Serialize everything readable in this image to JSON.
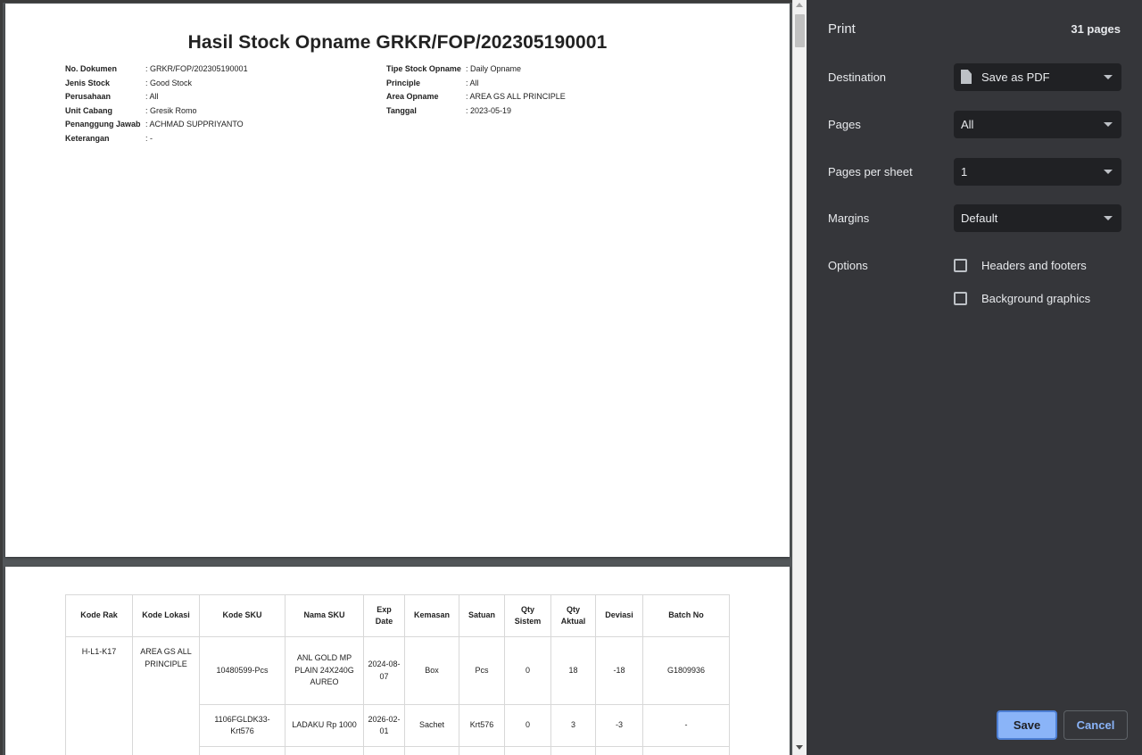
{
  "document": {
    "title": "Hasil Stock Opname GRKR/FOP/202305190001",
    "meta_left": [
      {
        "key": "No. Dokumen",
        "value": ": GRKR/FOP/202305190001"
      },
      {
        "key": "Jenis Stock",
        "value": ": Good Stock"
      },
      {
        "key": "Perusahaan",
        "value": ": All"
      },
      {
        "key": "Unit Cabang",
        "value": ": Gresik Romo"
      },
      {
        "key": "Penanggung Jawab",
        "value": ": ACHMAD SUPPRIYANTO"
      },
      {
        "key": "Keterangan",
        "value": ": -"
      }
    ],
    "meta_right": [
      {
        "key": "Tipe Stock Opname",
        "value": ": Daily Opname"
      },
      {
        "key": "Principle",
        "value": ": All"
      },
      {
        "key": "Area Opname",
        "value": ": AREA GS ALL PRINCIPLE"
      },
      {
        "key": "Tanggal",
        "value": ": 2023-05-19"
      }
    ]
  },
  "table": {
    "headers": [
      "Kode Rak",
      "Kode Lokasi",
      "Kode SKU",
      "Nama SKU",
      "Exp Date",
      "Kemasan",
      "Satuan",
      "Qty Sistem",
      "Qty Aktual",
      "Deviasi",
      "Batch No"
    ],
    "rak": "H-L1-K17",
    "lokasi": "AREA GS ALL PRINCIPLE",
    "rows": [
      {
        "sku": "10480599-Pcs",
        "nama": "ANL GOLD MP PLAIN 24X240G AUREO",
        "exp": "2024-08-07",
        "kemasan": "Box",
        "satuan": "Pcs",
        "qty_sistem": "0",
        "qty_aktual": "18",
        "deviasi": "-18",
        "batch": "G1809936"
      },
      {
        "sku": "1106FGLDK33-Krt576",
        "nama": "LADAKU Rp 1000",
        "exp": "2026-02-01",
        "kemasan": "Sachet",
        "satuan": "Krt576",
        "qty_sistem": "0",
        "qty_aktual": "3",
        "deviasi": "-3",
        "batch": "-"
      }
    ]
  },
  "panel": {
    "title": "Print",
    "page_count": "31 pages",
    "destination_label": "Destination",
    "destination_value": "Save as PDF",
    "pages_label": "Pages",
    "pages_value": "All",
    "pps_label": "Pages per sheet",
    "pps_value": "1",
    "margins_label": "Margins",
    "margins_value": "Default",
    "options_label": "Options",
    "opt_headers": "Headers and footers",
    "opt_background": "Background graphics",
    "save": "Save",
    "cancel": "Cancel"
  }
}
